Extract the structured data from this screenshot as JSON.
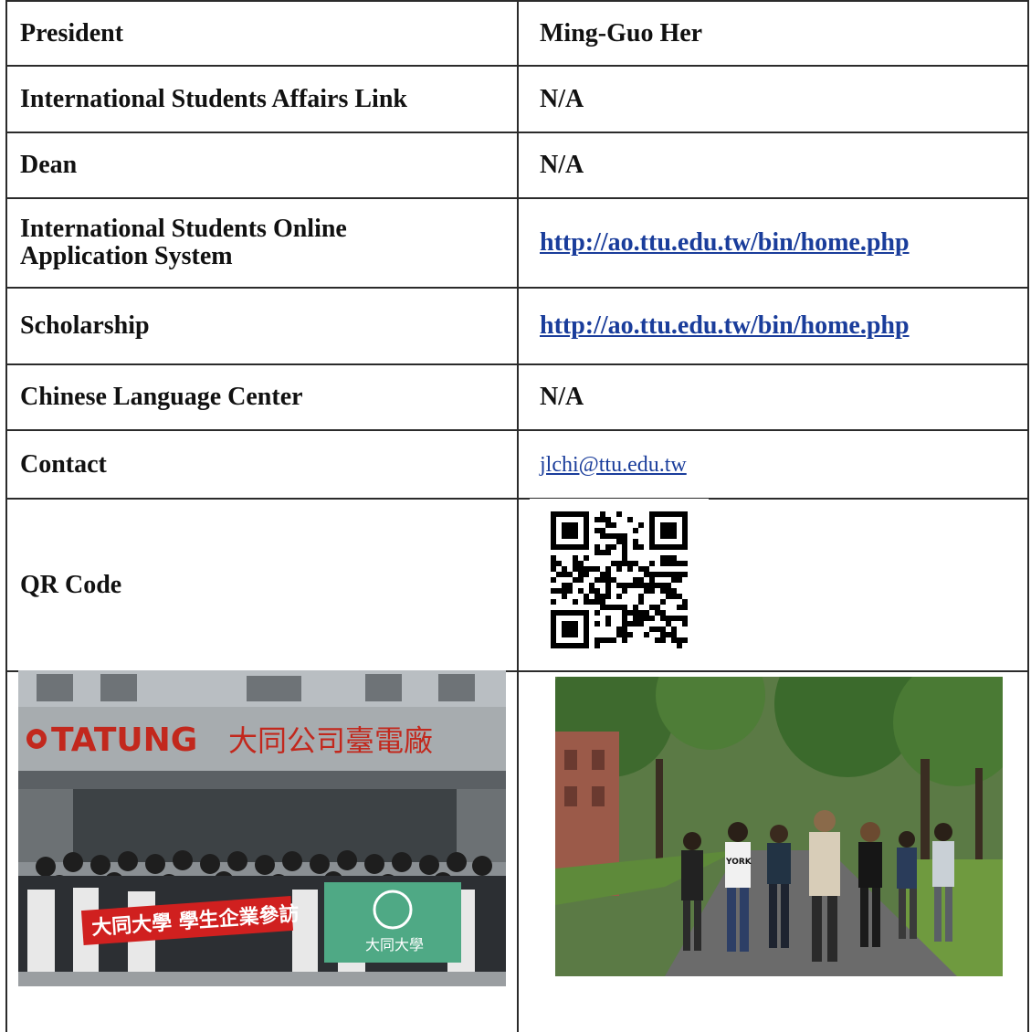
{
  "rows": [
    {
      "label": "President",
      "value": "Ming-Guo Her"
    },
    {
      "label": "International Students Affairs Link",
      "value": "N/A"
    },
    {
      "label": "Dean",
      "value": "N/A"
    },
    {
      "label_line1": "International Students Online",
      "label_line2": "Application System",
      "value": "http://ao.ttu.edu.tw/bin/home.php"
    },
    {
      "label": "Scholarship",
      "value": "http://ao.ttu.edu.tw/bin/home.php"
    },
    {
      "label": "Chinese Language Center",
      "value": "N/A"
    },
    {
      "label": "Contact",
      "value": "jlchi@ttu.edu.tw"
    },
    {
      "label": "QR Code"
    }
  ],
  "photos": {
    "left": {
      "sign_latin": "TATUNG",
      "sign_cjk": "大同公司臺電廠",
      "banner": "大同大學 學生企業參訪",
      "flag": "大同大學"
    },
    "right": {
      "shirt": "YORK"
    }
  },
  "colors": {
    "link": "#1a3d9b",
    "border": "#2b2b2b"
  }
}
